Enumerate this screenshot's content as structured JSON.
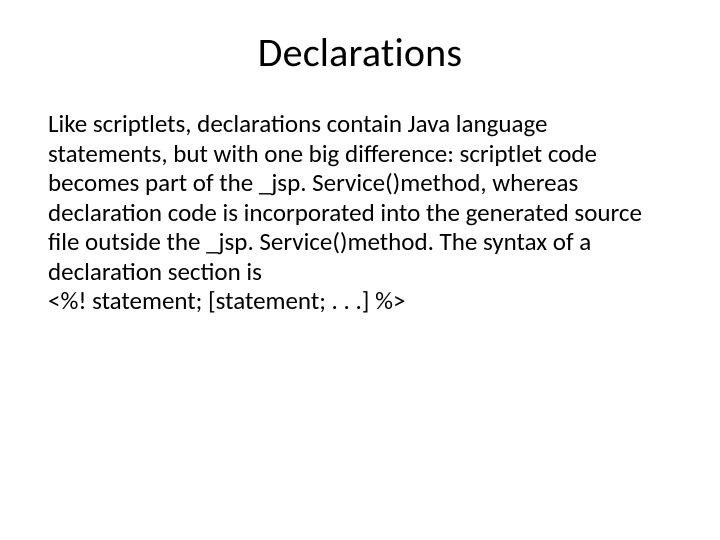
{
  "slide": {
    "title": "Declarations",
    "body": "Like scriptlets, declarations contain Java language statements, but with one big difference: scriptlet code becomes part of the _jsp. Service()method, whereas declaration code is incorporated into the generated source file outside the _jsp. Service()method. The syntax of a declaration section is",
    "syntax": "<%! statement; [statement; . . .] %>"
  }
}
